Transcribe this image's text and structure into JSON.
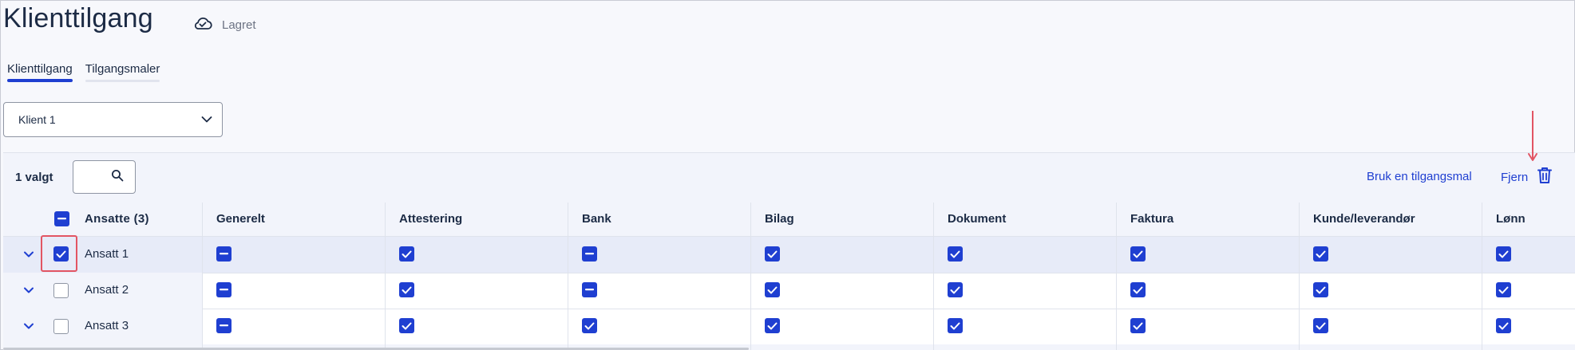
{
  "page": {
    "title": "Klienttilgang",
    "save_status": "Lagret"
  },
  "tabs": [
    {
      "label": "Klienttilgang",
      "active": true
    },
    {
      "label": "Tilgangsmaler",
      "active": false
    }
  ],
  "client_select": {
    "value": "Klient 1"
  },
  "toolbar": {
    "selected_count": "1 valgt",
    "use_template_label": "Bruk en tilgangsmal",
    "remove_label": "Fjern"
  },
  "table": {
    "employee_header": "Ansatte (3)",
    "columns": [
      "Generelt",
      "Attestering",
      "Bank",
      "Bilag",
      "Dokument",
      "Faktura",
      "Kunde/leverandør",
      "Lønn"
    ],
    "rows": [
      {
        "name": "Ansatt 1",
        "selected": true,
        "permissions": [
          "partial",
          "checked",
          "partial",
          "checked",
          "checked",
          "checked",
          "checked",
          "checked"
        ]
      },
      {
        "name": "Ansatt 2",
        "selected": false,
        "permissions": [
          "partial",
          "checked",
          "partial",
          "checked",
          "checked",
          "checked",
          "checked",
          "checked"
        ]
      },
      {
        "name": "Ansatt 3",
        "selected": false,
        "permissions": [
          "partial",
          "checked",
          "checked",
          "checked",
          "checked",
          "checked",
          "checked",
          "checked"
        ]
      }
    ]
  },
  "colors": {
    "accent": "#1f3fd1",
    "annotation": "#e25563",
    "selected_row": "#e7ebf8"
  }
}
